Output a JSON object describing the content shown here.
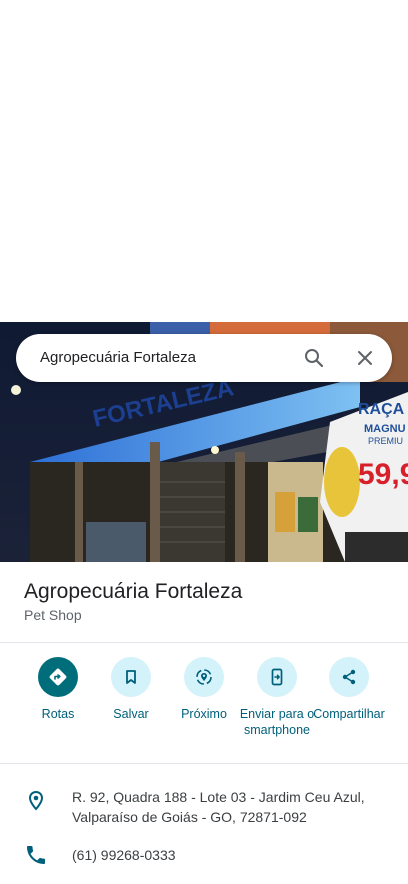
{
  "search": {
    "query": "Agropecuária Fortaleza"
  },
  "place": {
    "name": "Agropecuária Fortaleza",
    "category": "Pet Shop"
  },
  "photo": {
    "sign_text": "FORTALEZA",
    "banner_text_1": "RAÇA",
    "banner_text_2": "MAGNU",
    "banner_text_3": "PREMIU",
    "price_text": "59,9"
  },
  "actions": [
    {
      "label": "Rotas",
      "icon": "directions-icon"
    },
    {
      "label": "Salvar",
      "icon": "bookmark-icon"
    },
    {
      "label": "Próximo",
      "icon": "nearby-icon"
    },
    {
      "label": "Enviar para o smartphone",
      "icon": "send-to-phone-icon"
    },
    {
      "label": "Compartilhar",
      "icon": "share-icon"
    }
  ],
  "info": {
    "address": "R. 92, Quadra 188 - Lote 03 - Jardim Ceu Azul, Valparaíso de Goiás - GO, 72871-092",
    "phone": "(61) 99268-0333"
  },
  "colors": {
    "accent": "#00607b",
    "primary_button": "#006e7a",
    "action_circle": "#d4f2f9"
  }
}
